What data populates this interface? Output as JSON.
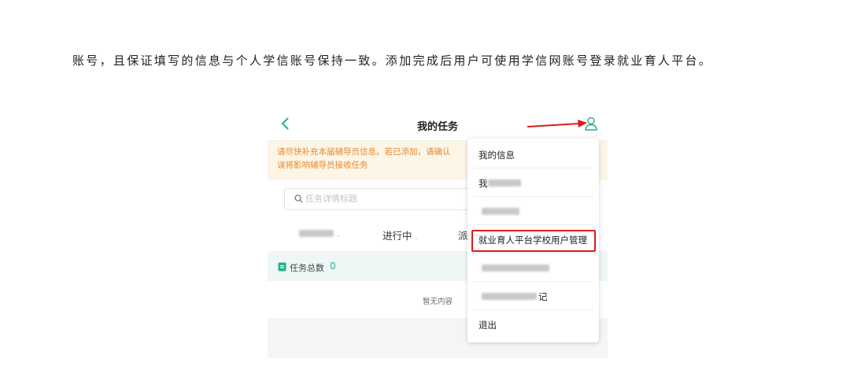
{
  "document": {
    "paragraph": "账号，且保证填写的信息与个人学信账号保持一致。添加完成后用户可使用学信网账号登录就业育人平台。"
  },
  "screenshot": {
    "header": {
      "title": "我的任务",
      "back_icon": "chevron-left-icon",
      "user_icon": "user-icon"
    },
    "notice": {
      "line1": "请尽快补充本届辅导员信息。若已添加，请确认",
      "line2": "误将影响辅导员接收任务"
    },
    "search": {
      "placeholder": "任务详情标题"
    },
    "tabs": [
      {
        "label": ""
      },
      {
        "label": "进行中"
      },
      {
        "label": "派"
      }
    ],
    "summary": {
      "label": "任务总数",
      "count": "0"
    },
    "empty_text": "暂无内容",
    "menu": {
      "items": [
        {
          "label": "我的信息"
        },
        {
          "label": "我"
        },
        {
          "label": ""
        },
        {
          "label": "就业育人平台学校用户管理"
        },
        {
          "label": ""
        },
        {
          "label": "记"
        },
        {
          "label": "退出"
        }
      ],
      "highlighted_index": 3
    },
    "colors": {
      "accent": "#22b08e",
      "notice_text": "#e78a2e",
      "annotation_red": "#d91c1c"
    }
  }
}
